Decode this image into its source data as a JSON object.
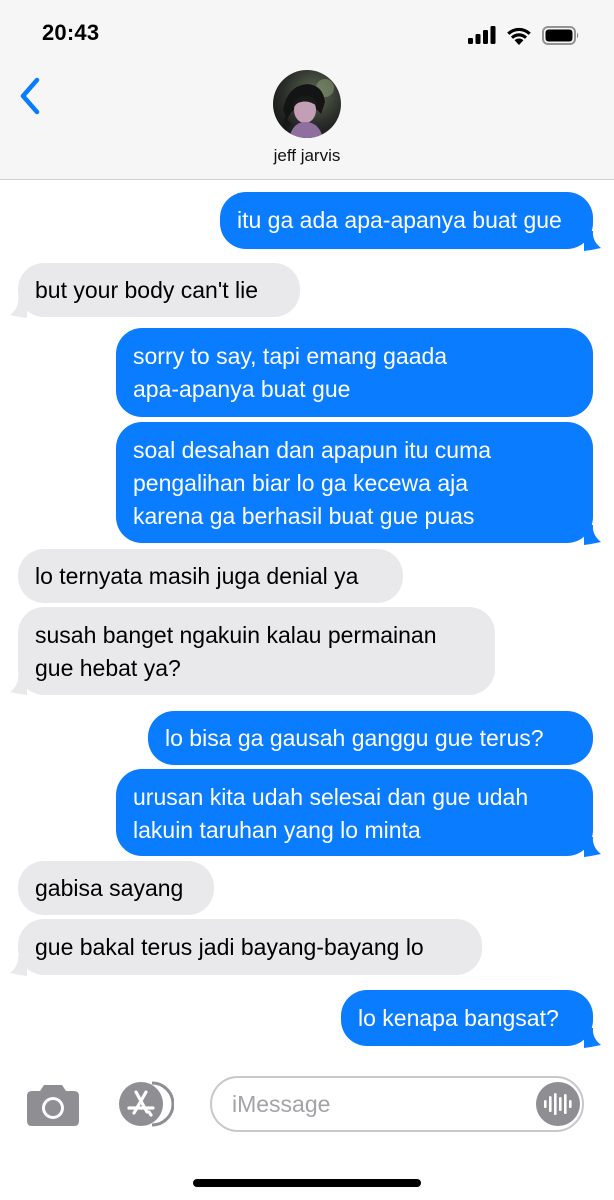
{
  "status_bar": {
    "time": "20:43"
  },
  "header": {
    "contact_name": "jeff jarvis",
    "icons": {
      "back": "chevron-left-icon",
      "signal": "cellular-signal-icon",
      "wifi": "wifi-icon",
      "battery": "battery-icon"
    }
  },
  "messages": [
    {
      "from": "me",
      "text": [
        "itu ga ada apa-apanya buat gue"
      ]
    },
    {
      "from": "them",
      "text": [
        "but your body can't lie"
      ]
    },
    {
      "from": "me",
      "text": [
        "sorry to say, tapi emang gaada",
        "apa-apanya buat gue"
      ]
    },
    {
      "from": "me",
      "text": [
        "soal desahan dan apapun itu cuma",
        "pengalihan biar lo ga kecewa aja",
        "karena ga berhasil buat gue puas"
      ]
    },
    {
      "from": "them",
      "text": [
        "lo ternyata masih juga denial ya"
      ]
    },
    {
      "from": "them",
      "text": [
        "susah banget ngakuin kalau permainan",
        "gue hebat ya?"
      ]
    },
    {
      "from": "me",
      "text": [
        "lo bisa ga gausah ganggu gue terus?"
      ]
    },
    {
      "from": "me",
      "text": [
        "urusan kita udah selesai dan gue udah",
        "lakuin taruhan yang lo minta"
      ]
    },
    {
      "from": "them",
      "text": [
        "gabisa sayang"
      ]
    },
    {
      "from": "them",
      "text": [
        "gue bakal terus jadi bayang-bayang lo"
      ]
    },
    {
      "from": "me",
      "text": [
        "lo kenapa bangsat?"
      ]
    }
  ],
  "input_bar": {
    "placeholder": "iMessage",
    "value": "",
    "icons": {
      "camera": "camera-icon",
      "apps": "app-store-icon",
      "audio": "audio-waveform-icon"
    }
  },
  "colors": {
    "sent_bubble": "#0a7cff",
    "received_bubble": "#e9e9eb",
    "accent": "#0a7cff",
    "header_background": "#f6f6f6"
  }
}
